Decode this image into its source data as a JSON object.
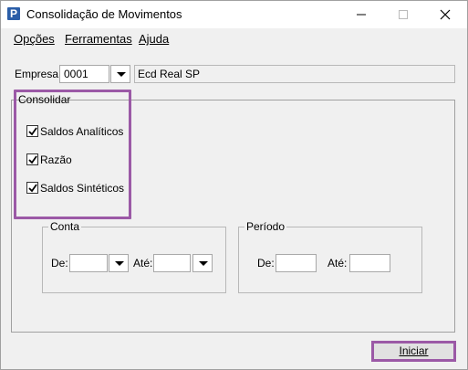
{
  "window": {
    "title": "Consolidação de Movimentos"
  },
  "menu": {
    "items": [
      "Opções",
      "Ferramentas",
      "Ajuda"
    ]
  },
  "empresa": {
    "label": "Empresa:",
    "code": "0001",
    "name": "Ecd Real SP"
  },
  "consolidar": {
    "caption": "Consolidar",
    "options": [
      {
        "label": "Saldos Analíticos",
        "checked": true
      },
      {
        "label": "Razão",
        "checked": true
      },
      {
        "label": "Saldos Sintéticos",
        "checked": true
      }
    ]
  },
  "conta": {
    "caption": "Conta",
    "de_label": "De:",
    "ate_label": "Até:",
    "de_value": "",
    "ate_value": ""
  },
  "periodo": {
    "caption": "Período",
    "de_label": "De:",
    "ate_label": "Até:",
    "de_value": "",
    "ate_value": ""
  },
  "actions": {
    "start_label": "Iniciar"
  },
  "colors": {
    "highlight": "#9b59a6",
    "app_icon": "#2b5ea8"
  }
}
